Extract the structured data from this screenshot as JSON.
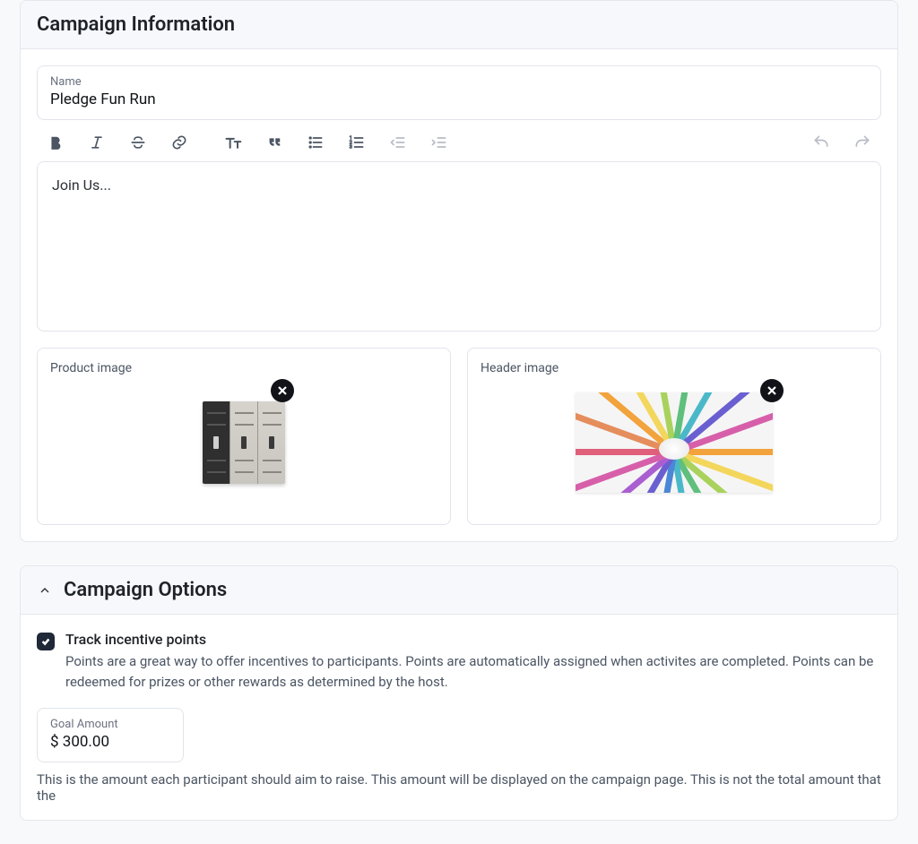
{
  "sections": {
    "campaign_info": {
      "title": "Campaign Information",
      "name_label": "Name",
      "name_value": "Pledge Fun Run",
      "editor_text": "Join Us...",
      "product_image_label": "Product image",
      "header_image_label": "Header image"
    },
    "campaign_options": {
      "title": "Campaign Options",
      "incentive_title": "Track incentive points",
      "incentive_desc": "Points are a great way to offer incentives to participants. Points are automatically assigned when activites are completed. Points can be redeemed for prizes or other rewards as determined by the host.",
      "goal_label": "Goal Amount",
      "goal_value": "$ 300.00",
      "goal_hint": "This is the amount each participant should aim to raise. This amount will be displayed on the campaign page. This is not the total amount that the"
    }
  }
}
